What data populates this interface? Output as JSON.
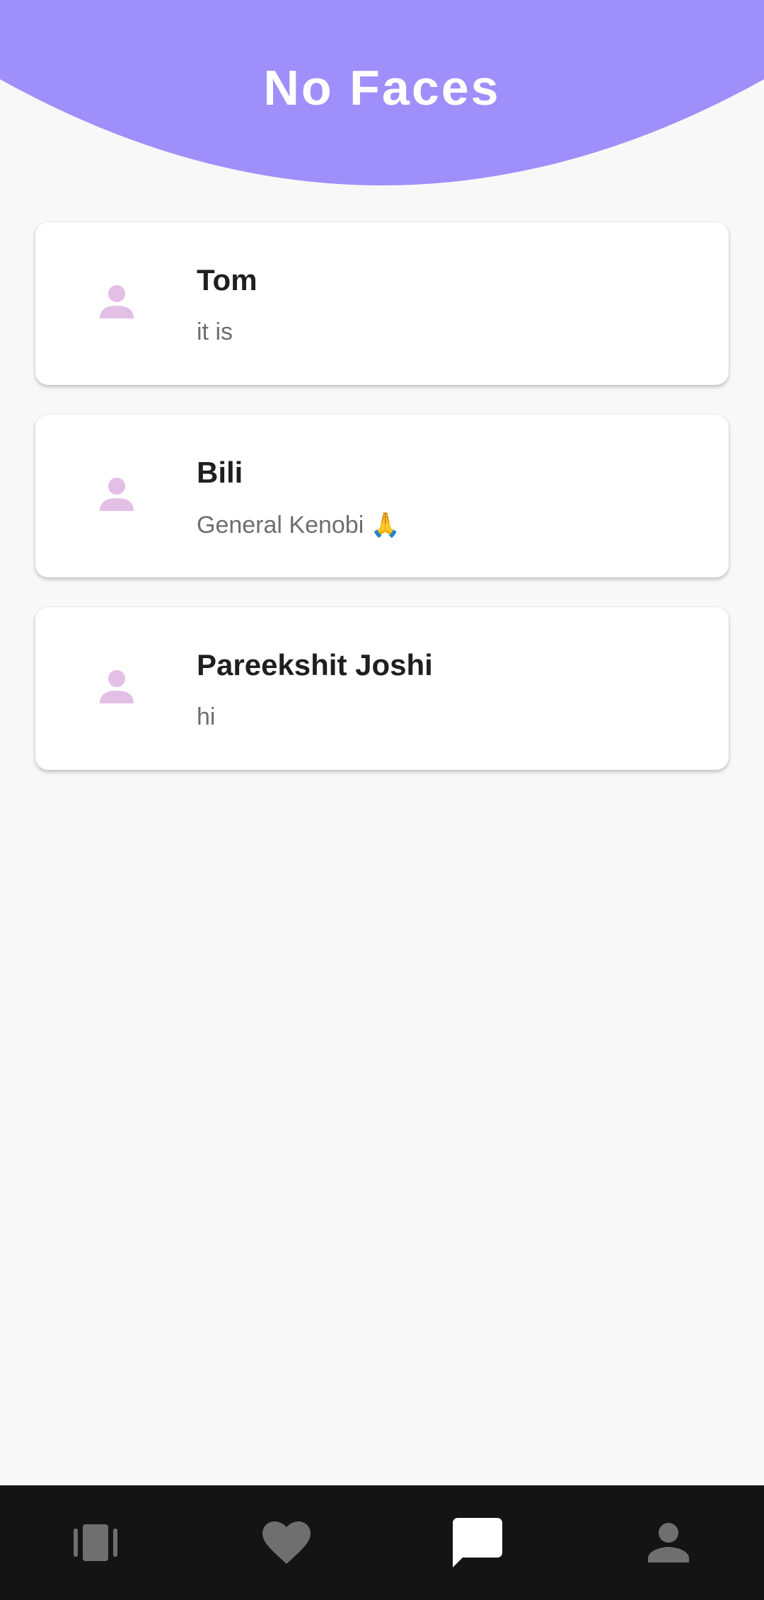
{
  "header": {
    "title": "No Faces",
    "color": "#9f8ffa"
  },
  "chats": [
    {
      "name": "Tom",
      "preview": "it is"
    },
    {
      "name": "Bili",
      "preview": "General Kenobi 🙏"
    },
    {
      "name": "Pareekshit Joshi",
      "preview": "hi"
    }
  ],
  "bottom_nav": {
    "items": [
      {
        "icon": "cards-icon",
        "active": false
      },
      {
        "icon": "heart-icon",
        "active": false
      },
      {
        "icon": "chat-icon",
        "active": true
      },
      {
        "icon": "person-icon",
        "active": false
      }
    ],
    "background": "#141414",
    "active_color": "#ffffff",
    "inactive_color": "#6f6f6f"
  },
  "colors": {
    "avatar": "#e3bfe6",
    "page_background": "#f8f8f8"
  }
}
